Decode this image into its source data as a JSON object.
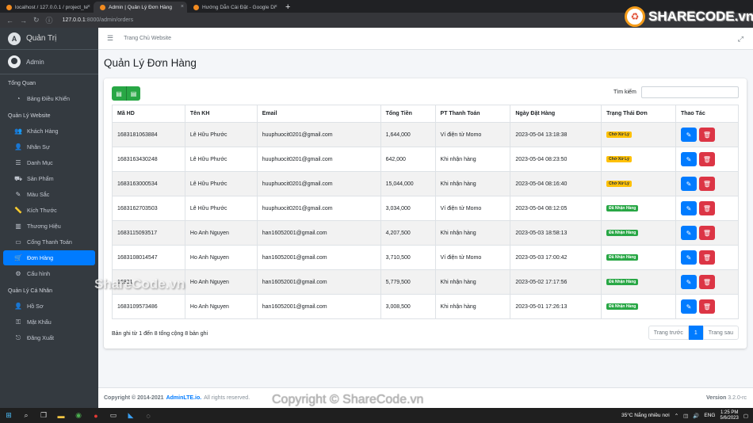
{
  "browser": {
    "tabs": [
      {
        "title": "localhost / 127.0.0.1 / project_te",
        "active": false
      },
      {
        "title": "Admin | Quản Lý Đơn Hàng",
        "active": true
      },
      {
        "title": "Hướng Dẫn Cài Đặt - Google Dr",
        "active": false
      }
    ],
    "new_tab": "+",
    "url_host": "127.0.0.1",
    "url_path": ":8000/admin/orders"
  },
  "sidebar": {
    "brand": "Quản Trị",
    "brand_letter": "A",
    "user": "Admin",
    "groups": [
      {
        "header": "Tổng Quan",
        "items": [
          {
            "label": "Bảng Điều Khiển",
            "icon": "tachometer-icon",
            "glyph": "◔",
            "active": false
          }
        ]
      },
      {
        "header": "Quản Lý Website",
        "items": [
          {
            "label": "Khách Hàng",
            "icon": "users-icon",
            "glyph": "👥",
            "active": false
          },
          {
            "label": "Nhân Sự",
            "icon": "user-tie-icon",
            "glyph": "👤",
            "active": false
          },
          {
            "label": "Danh Mục",
            "icon": "list-icon",
            "glyph": "☰",
            "active": false
          },
          {
            "label": "Sản Phẩm",
            "icon": "car-icon",
            "glyph": "⛟",
            "active": false
          },
          {
            "label": "Màu Sắc",
            "icon": "brush-icon",
            "glyph": "✎",
            "active": false
          },
          {
            "label": "Kích Thước",
            "icon": "ruler-icon",
            "glyph": "📏",
            "active": false
          },
          {
            "label": "Thương Hiệu",
            "icon": "building-icon",
            "glyph": "▥",
            "active": false
          },
          {
            "label": "Cổng Thanh Toán",
            "icon": "money-icon",
            "glyph": "▭",
            "active": false
          },
          {
            "label": "Đơn Hàng",
            "icon": "cart-icon",
            "glyph": "🛒",
            "active": true
          },
          {
            "label": "Cấu hình",
            "icon": "cogs-icon",
            "glyph": "⚙",
            "active": false
          }
        ]
      },
      {
        "header": "Quản Lý Cá Nhân",
        "items": [
          {
            "label": "Hồ Sơ",
            "icon": "user-icon",
            "glyph": "👤",
            "active": false
          },
          {
            "label": "Mật Khẩu",
            "icon": "key-icon",
            "glyph": "⚿",
            "active": false
          },
          {
            "label": "Đăng Xuất",
            "icon": "sign-out-icon",
            "glyph": "⎋",
            "active": false
          }
        ]
      }
    ]
  },
  "topnav": {
    "home_link": "Trang Chủ Website"
  },
  "main": {
    "title": "Quản Lý Đơn Hàng",
    "search_label": "Tìm kiếm",
    "search_value": "",
    "columns": [
      "Mã HD",
      "Tên KH",
      "Email",
      "Tổng Tiền",
      "PT Thanh Toán",
      "Ngày Đặt Hàng",
      "Trạng Thái Đơn",
      "Thao Tác"
    ],
    "rows": [
      {
        "id": "1683181063884",
        "name": "Lê Hữu Phước",
        "email": "huuphuocit0201@gmail.com",
        "total": "1,644,000",
        "payment": "Ví điện tử Momo",
        "date": "2023-05-04 13:18:38",
        "status": "Chờ Xử Lý",
        "status_type": "warn"
      },
      {
        "id": "1683163430248",
        "name": "Lê Hữu Phước",
        "email": "huuphuocit0201@gmail.com",
        "total": "642,000",
        "payment": "Khi nhận hàng",
        "date": "2023-05-04 08:23:50",
        "status": "Chờ Xử Lý",
        "status_type": "warn"
      },
      {
        "id": "1683163000534",
        "name": "Lê Hữu Phước",
        "email": "huuphuocit0201@gmail.com",
        "total": "15,044,000",
        "payment": "Khi nhận hàng",
        "date": "2023-05-04 08:16:40",
        "status": "Chờ Xử Lý",
        "status_type": "warn"
      },
      {
        "id": "1683162703503",
        "name": "Lê Hữu Phước",
        "email": "huuphuocit0201@gmail.com",
        "total": "3,034,000",
        "payment": "Ví điện tử Momo",
        "date": "2023-05-04 08:12:05",
        "status": "Đã Nhận Hàng",
        "status_type": "ok"
      },
      {
        "id": "1683115093517",
        "name": "Ho Anh Nguyen",
        "email": "han16052001@gmail.com",
        "total": "4,207,500",
        "payment": "Khi nhận hàng",
        "date": "2023-05-03 18:58:13",
        "status": "Đã Nhận Hàng",
        "status_type": "ok"
      },
      {
        "id": "1683108014547",
        "name": "Ho Anh Nguyen",
        "email": "han16052001@gmail.com",
        "total": "3,710,500",
        "payment": "Ví điện tử Momo",
        "date": "2023-05-03 17:00:42",
        "status": "Đã Nhận Hàng",
        "status_type": "ok"
      },
      {
        "id": "16831",
        "name": "Ho Anh Nguyen",
        "email": "han16052001@gmail.com",
        "total": "5,779,500",
        "payment": "Khi nhận hàng",
        "date": "2023-05-02 17:17:56",
        "status": "Đã Nhận Hàng",
        "status_type": "ok"
      },
      {
        "id": "1683109573486",
        "name": "Ho Anh Nguyen",
        "email": "han16052001@gmail.com",
        "total": "3,008,500",
        "payment": "Khi nhận hàng",
        "date": "2023-05-01 17:26:13",
        "status": "Đã Nhận Hàng",
        "status_type": "ok"
      }
    ],
    "info": "Bản ghi từ 1 đến 8 tổng cộng 8 bản ghi",
    "pager": {
      "prev": "Trang trước",
      "current": "1",
      "next": "Trang sau"
    }
  },
  "footer": {
    "copyright": "Copyright © 2014-2021",
    "brand": "AdminLTE.io.",
    "rights": "All rights reserved.",
    "version_label": "Version",
    "version": "3.2.0-rc"
  },
  "watermarks": {
    "logo": "SHARECODE.vn",
    "middle": "ShareCode.vn",
    "bottom": "Copyright © ShareCode.vn"
  },
  "taskbar": {
    "weather": "35°C  Nắng nhiều nơi",
    "lang": "ENG",
    "time": "1:25 PM",
    "date": "5/6/2023"
  },
  "colors": {
    "primary": "#007bff",
    "success": "#28a745",
    "warning": "#ffc107",
    "danger": "#dc3545",
    "sidebar": "#343a40"
  }
}
